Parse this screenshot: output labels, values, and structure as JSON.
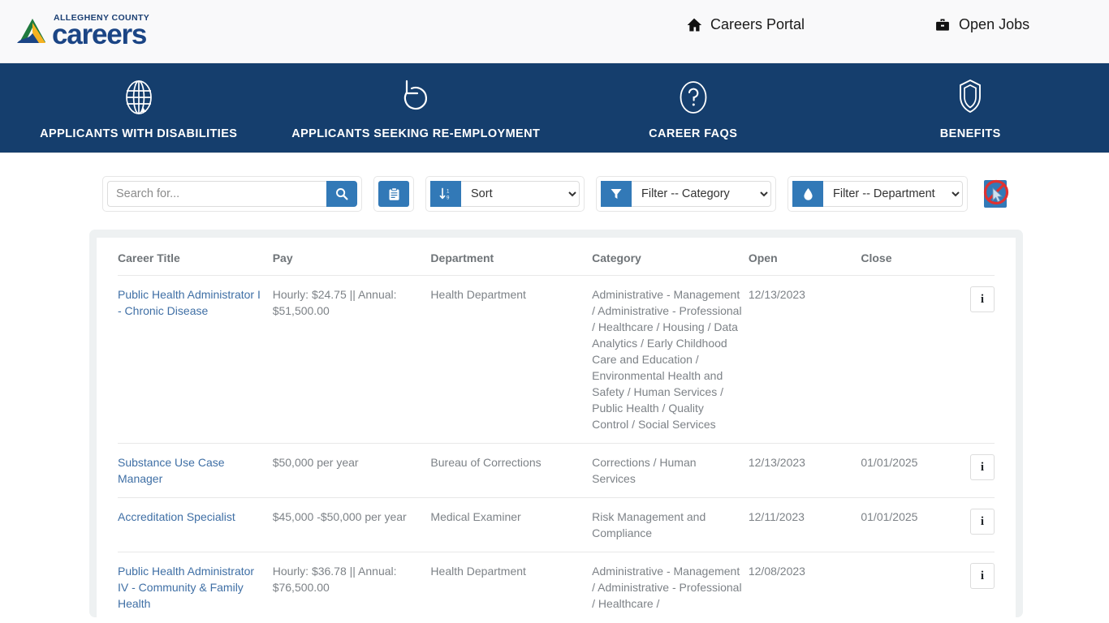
{
  "brand": {
    "line1": "ALLEGHENY COUNTY",
    "line2": "careers",
    "colors": {
      "green": "#1f7a3d",
      "gold": "#f6b221",
      "navy": "#1b4585",
      "bar": "#153e6d",
      "button": "#3279b7"
    }
  },
  "top_nav": [
    {
      "label": "Careers Portal",
      "icon": "home-icon"
    },
    {
      "label": "Open Jobs",
      "icon": "briefcase-icon"
    }
  ],
  "blue_nav": [
    {
      "label": "APPLICANTS WITH DISABILITIES",
      "icon": "globe-icon"
    },
    {
      "label": "APPLICANTS SEEKING RE-EMPLOYMENT",
      "icon": "rotate-left-icon"
    },
    {
      "label": "CAREER FAQS",
      "icon": "question-circle-icon"
    },
    {
      "label": "BENEFITS",
      "icon": "shield-icon"
    }
  ],
  "toolbar": {
    "search_placeholder": "Search for...",
    "search_value": "",
    "search_icon": "magnifier-icon",
    "clipboard_icon": "clipboard-icon",
    "sort_icon": "sort-amount-icon",
    "sort_selected": "Sort",
    "sort_options": [
      "Sort"
    ],
    "filter_category_icon": "funnel-icon",
    "filter_category_selected": "Filter -- Category",
    "filter_category_options": [
      "Filter -- Category"
    ],
    "filter_department_icon": "droplet-icon",
    "filter_department_selected": "Filter -- Department",
    "filter_department_options": [
      "Filter -- Department"
    ],
    "clear_icon": "no-entry-cursor-icon"
  },
  "table": {
    "columns": [
      "Career Title",
      "Pay",
      "Department",
      "Category",
      "Open",
      "Close"
    ],
    "info_label": "i",
    "rows": [
      {
        "title": "Public Health Administrator I - Chronic Disease",
        "pay": "Hourly: $24.75 || Annual: $51,500.00",
        "department": "Health Department",
        "category": "Administrative - Management / Administrative - Professional / Healthcare / Housing / Data Analytics / Early Childhood Care and Education / Environmental Health and Safety / Human Services / Public Health / Quality Control / Social Services",
        "open": "12/13/2023",
        "close": ""
      },
      {
        "title": "Substance Use Case Manager",
        "pay": "$50,000 per year",
        "department": "Bureau of Corrections",
        "category": "Corrections / Human Services",
        "open": "12/13/2023",
        "close": "01/01/2025"
      },
      {
        "title": "Accreditation Specialist",
        "pay": "$45,000 -$50,000 per year",
        "department": "Medical Examiner",
        "category": "Risk Management and Compliance",
        "open": "12/11/2023",
        "close": "01/01/2025"
      },
      {
        "title": "Public Health Administrator IV - Community & Family Health",
        "pay": "Hourly: $36.78 || Annual: $76,500.00",
        "department": "Health Department",
        "category": "Administrative - Management / Administrative - Professional / Healthcare /",
        "open": "12/08/2023",
        "close": ""
      }
    ]
  }
}
